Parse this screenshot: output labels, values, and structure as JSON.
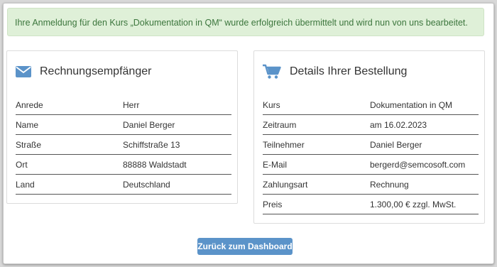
{
  "alert": {
    "message": "Ihre Anmeldung für den Kurs „Dokumentation in QM“ wurde erfolgreich übermittelt und wird nun von uns bearbeitet."
  },
  "recipient": {
    "icon": "envelope-icon",
    "title": "Rechnungsempfänger",
    "rows": [
      {
        "label": "Anrede",
        "value": "Herr"
      },
      {
        "label": "Name",
        "value": "Daniel Berger"
      },
      {
        "label": "Straße",
        "value": "Schiffstraße 13"
      },
      {
        "label": "Ort",
        "value": "88888 Waldstadt"
      },
      {
        "label": "Land",
        "value": "Deutschland"
      }
    ]
  },
  "order": {
    "icon": "shopping-cart-icon",
    "title": "Details Ihrer Bestellung",
    "rows": [
      {
        "label": "Kurs",
        "value": "Dokumentation in QM"
      },
      {
        "label": "Zeitraum",
        "value": "am 16.02.2023"
      },
      {
        "label": "Teilnehmer",
        "value": "Daniel Berger"
      },
      {
        "label": "E-Mail",
        "value": "bergerd@semcosoft.com"
      },
      {
        "label": "Zahlungsart",
        "value": "Rechnung"
      },
      {
        "label": "Preis",
        "value": "1.300,00 € zzgl. MwSt."
      }
    ]
  },
  "actions": {
    "back_label": "Zurück zum Dashboard"
  },
  "colors": {
    "accent": "#5b93c9",
    "alert_bg": "#dff0d8",
    "alert_text": "#3c763d"
  }
}
